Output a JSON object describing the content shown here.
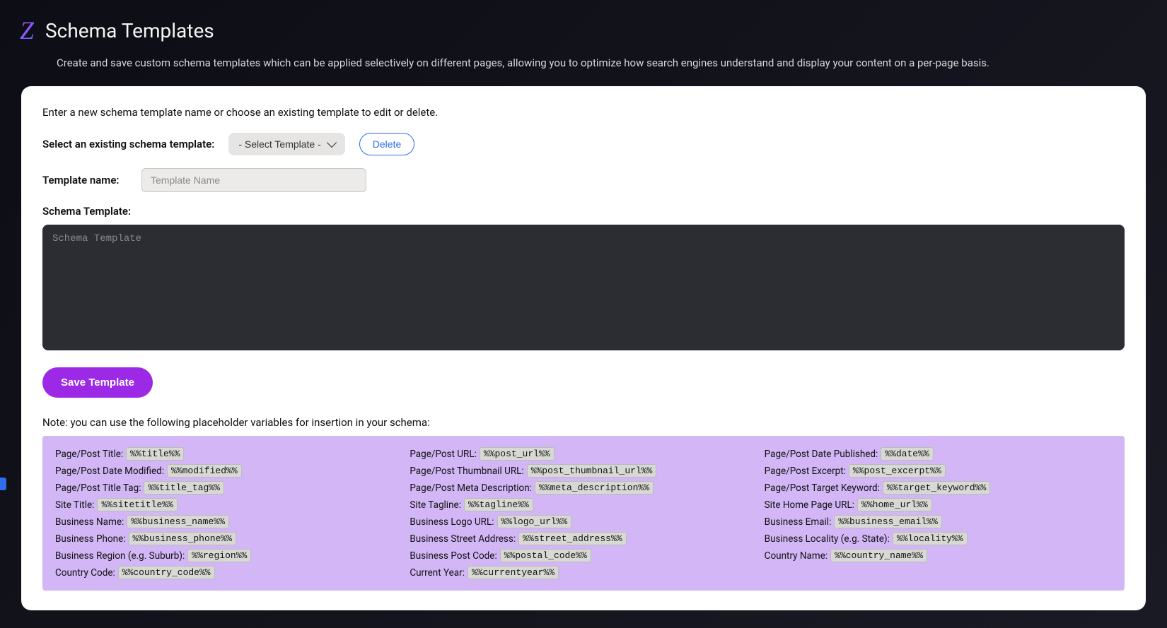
{
  "header": {
    "logo_letter": "Z",
    "title": "Schema Templates",
    "subtitle": "Create and save custom schema templates which can be applied selectively on different pages, allowing you to optimize how search engines understand and display your content on a per-page basis."
  },
  "form": {
    "instruction": "Enter a new schema template name or choose an existing template to edit or delete.",
    "select_label": "Select an existing schema template:",
    "select_placeholder": "- Select Template -",
    "delete_label": "Delete",
    "template_name_label": "Template name:",
    "template_name_placeholder": "Template Name",
    "schema_label": "Schema Template:",
    "schema_placeholder": "Schema Template",
    "save_label": "Save Template",
    "note": "Note: you can use the following placeholder variables for insertion in your schema:"
  },
  "placeholders": [
    {
      "label": "Page/Post Title: ",
      "code": "%%title%%"
    },
    {
      "label": "Page/Post URL: ",
      "code": "%%post_url%%"
    },
    {
      "label": "Page/Post Date Published: ",
      "code": "%%date%%"
    },
    {
      "label": "Page/Post Date Modified: ",
      "code": "%%modified%%"
    },
    {
      "label": "Page/Post Thumbnail URL: ",
      "code": "%%post_thumbnail_url%%"
    },
    {
      "label": "Page/Post Excerpt: ",
      "code": "%%post_excerpt%%"
    },
    {
      "label": "Page/Post Title Tag: ",
      "code": "%%title_tag%%"
    },
    {
      "label": "Page/Post Meta Description: ",
      "code": "%%meta_description%%"
    },
    {
      "label": "Page/Post Target Keyword: ",
      "code": "%%target_keyword%%"
    },
    {
      "label": "Site Title: ",
      "code": "%%sitetitle%%"
    },
    {
      "label": "Site Tagline: ",
      "code": "%%tagline%%"
    },
    {
      "label": "Site Home Page URL: ",
      "code": "%%home_url%%"
    },
    {
      "label": "Business Name: ",
      "code": "%%business_name%%"
    },
    {
      "label": "Business Logo URL: ",
      "code": "%%logo_url%%"
    },
    {
      "label": "Business Email: ",
      "code": "%%business_email%%"
    },
    {
      "label": "Business Phone: ",
      "code": "%%business_phone%%"
    },
    {
      "label": "Business Street Address: ",
      "code": "%%street_address%%"
    },
    {
      "label": "Business Locality (e.g. State): ",
      "code": "%%locality%%"
    },
    {
      "label": "Business Region (e.g. Suburb): ",
      "code": "%%region%%"
    },
    {
      "label": "Business Post Code: ",
      "code": "%%postal_code%%"
    },
    {
      "label": "Country Name: ",
      "code": "%%country_name%%"
    },
    {
      "label": "Country Code: ",
      "code": "%%country_code%%"
    },
    {
      "label": "Current Year: ",
      "code": "%%currentyear%%"
    },
    {
      "label": "",
      "code": ""
    }
  ]
}
